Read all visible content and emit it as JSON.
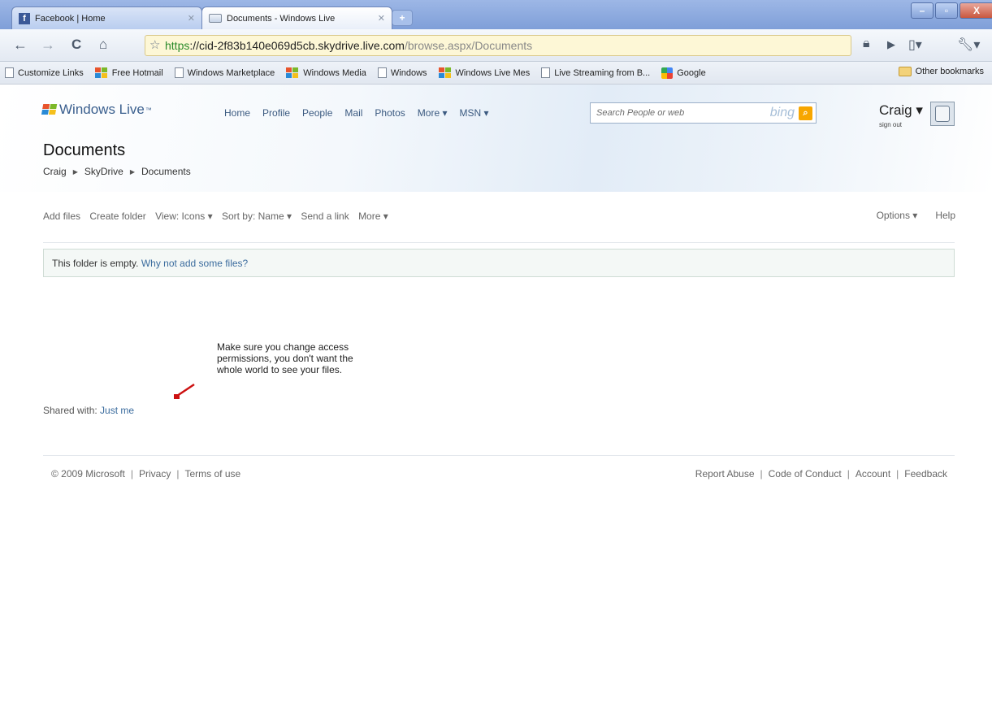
{
  "browser": {
    "tabs": [
      {
        "label": "Facebook | Home",
        "icon": "facebook-icon",
        "active": false
      },
      {
        "label": "Documents - Windows Live",
        "icon": "document-icon",
        "active": true
      }
    ],
    "new_tab": "+",
    "window_controls": {
      "minimize": "–",
      "maximize": "▫",
      "close": "X"
    },
    "url": {
      "scheme": "https",
      "host": "://cid-2f83b140e069d5cb.skydrive.live.com",
      "path": "/browse.aspx/Documents"
    },
    "bookmarks": [
      {
        "label": "Customize Links",
        "icon": "page-icon"
      },
      {
        "label": "Free Hotmail",
        "icon": "windows-live-icon"
      },
      {
        "label": "Windows Marketplace",
        "icon": "page-icon"
      },
      {
        "label": "Windows Media",
        "icon": "windows-live-icon"
      },
      {
        "label": "Windows",
        "icon": "page-icon"
      },
      {
        "label": "Windows Live Mes",
        "icon": "windows-live-icon"
      },
      {
        "label": "Live Streaming from B...",
        "icon": "page-icon"
      },
      {
        "label": "Google",
        "icon": "google-icon"
      }
    ],
    "other_bookmarks": "Other bookmarks"
  },
  "header": {
    "logo": "Windows Live",
    "logo_tm": "™",
    "nav": [
      "Home",
      "Profile",
      "People",
      "Mail",
      "Photos",
      "More ▾",
      "MSN ▾"
    ],
    "search_placeholder": "Search People or web",
    "bing": "bing",
    "user_name": "Craig",
    "sign_out": "sign out",
    "page_title": "Documents",
    "breadcrumb": [
      "Craig",
      "SkyDrive",
      "Documents"
    ]
  },
  "commands": {
    "left": [
      "Add files",
      "Create folder",
      "View: Icons ▾",
      "Sort by: Name ▾",
      "Send a link",
      "More ▾"
    ],
    "right": [
      "Options ▾",
      "Help"
    ]
  },
  "notice": {
    "text": "This folder is empty.",
    "link": "Why not add some files?"
  },
  "annotation": {
    "text": "Make sure you change access permissions, you don't want the whole world to see your files.",
    "arrow_color": "#cc1111"
  },
  "sharing": {
    "label": "Shared with:",
    "value": "Just me"
  },
  "footer": {
    "left": [
      "© 2009 Microsoft",
      "Privacy",
      "Terms of use"
    ],
    "right": [
      "Report Abuse",
      "Code of Conduct",
      "Account",
      "Feedback"
    ]
  }
}
